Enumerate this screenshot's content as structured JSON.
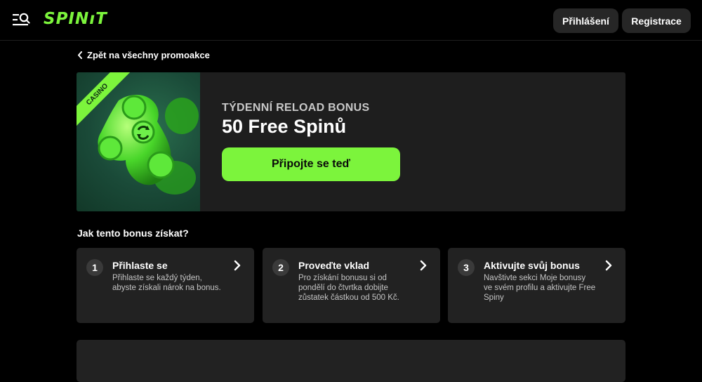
{
  "header": {
    "logo_text": "SPINıT",
    "login_label": "Přihlášení",
    "register_label": "Registrace",
    "brand_color": "#7cf43c"
  },
  "nav": {
    "back_label": "Zpět na všechny promoakce"
  },
  "promo": {
    "badge": "CASINO",
    "subtitle": "TÝDENNÍ RELOAD BONUS",
    "title": "50 Free Spinů",
    "cta_label": "Připojte se teď"
  },
  "how_to": {
    "title": "Jak tento bonus získat?",
    "steps": [
      {
        "num": "1",
        "title": "Přihlaste se",
        "desc": "Přihlaste se každý týden, abyste získali nárok na bonus."
      },
      {
        "num": "2",
        "title": "Proveďte vklad",
        "desc": "Pro získání bonusu si od pondělí do čtvrtka dobijte zůstatek částkou od 500 Kč."
      },
      {
        "num": "3",
        "title": "Aktivujte svůj bonus",
        "desc": "Navštivte sekci Moje bonusy ve svém profilu a aktivujte Free Spiny"
      }
    ]
  },
  "icons": {
    "menu": "menu-search-icon",
    "back": "chevron-left-icon",
    "step_arrow": "chevron-right-icon"
  }
}
